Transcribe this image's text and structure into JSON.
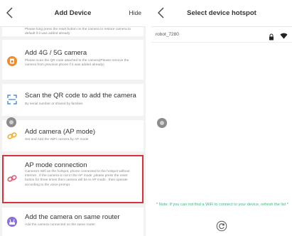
{
  "left": {
    "header": {
      "title": "Add Device",
      "hide_label": "Hide"
    },
    "cards": [
      {
        "id": "reset",
        "title": "",
        "desc": "Please long press the reset button on the camera to restore camera to default if it was added already",
        "icon": ""
      },
      {
        "id": "4g",
        "title": "Add 4G / 5G camera",
        "desc": "Please scan the QR code attached to the camera(Please remove the camera from previous phone if it was added already)",
        "icon": "sim-card-icon",
        "icon_color": "#f08c2e"
      },
      {
        "id": "qr",
        "title": "Scan the QR code to add the camera",
        "desc": "By serial number or shared by families",
        "icon": "qr-scan-icon",
        "icon_color": "#4a8fd8"
      },
      {
        "id": "ap",
        "title": "Add camera (AP mode)",
        "desc": "Set and Add the WiFi camera by AP mode",
        "icon": "link-icon",
        "icon_color": "#f0b22e"
      },
      {
        "id": "apconn",
        "title": "AP mode connection",
        "desc": "Camera's Wifi as the hotspot, phone connected to the hotspot without internet , If the camera is not in the AP mode ,please press the reset button for three times then camera will be in AP mode , then operate according to the voice prompt.",
        "icon": "link-icon",
        "icon_color": "#e0607a",
        "highlight_color": "#d9303a"
      },
      {
        "id": "router",
        "title": "Add the camera on same router",
        "desc": "Add the camera connected on the same router.",
        "icon": "router-icon",
        "icon_color": "#8b6fd6"
      }
    ]
  },
  "right": {
    "header": {
      "title": "Select device hotspot"
    },
    "wifi": [
      {
        "ssid": "robot_7280"
      }
    ],
    "note": "* Note: If you can not find a WiFi to connect to your device, refresh the list *",
    "note_color": "#3ab87a"
  }
}
